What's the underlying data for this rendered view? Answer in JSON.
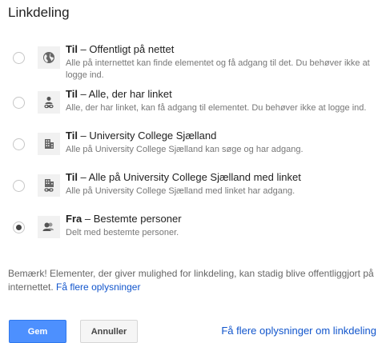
{
  "dialog": {
    "title": "Linkdeling"
  },
  "options": [
    {
      "prefix": "Til",
      "title": " – Offentligt på nettet",
      "description": "Alle på internettet kan finde elementet og få adgang til det. Du behøver ikke at logge ind.",
      "icon": "globe-icon",
      "selected": false
    },
    {
      "prefix": "Til",
      "title": " – Alle, der har linket",
      "description": "Alle, der har linket, kan få adgang til elementet. Du behøver ikke at logge ind.",
      "icon": "person-link-icon",
      "selected": false
    },
    {
      "prefix": "Til",
      "title": " – University College Sjælland",
      "description": "Alle på University College Sjælland kan søge og har adgang.",
      "icon": "building-icon",
      "selected": false
    },
    {
      "prefix": "Til",
      "title": " – Alle på University College Sjælland med linket",
      "description": "Alle på University College Sjælland med linket har adgang.",
      "icon": "building-link-icon",
      "selected": false
    },
    {
      "prefix": "Fra",
      "title": " – Bestemte personer",
      "description": "Delt med bestemte personer.",
      "icon": "people-icon",
      "selected": true
    }
  ],
  "note": {
    "text": "Bemærk! Elementer, der giver mulighed for linkdeling, kan stadig blive offentliggjort på internettet.",
    "link": "Få flere oplysninger"
  },
  "buttons": {
    "save": "Gem",
    "cancel": "Annuller"
  },
  "footer_link": "Få flere oplysninger om linkdeling",
  "colors": {
    "primary_button": "#4d90fe",
    "link": "#1155cc"
  }
}
